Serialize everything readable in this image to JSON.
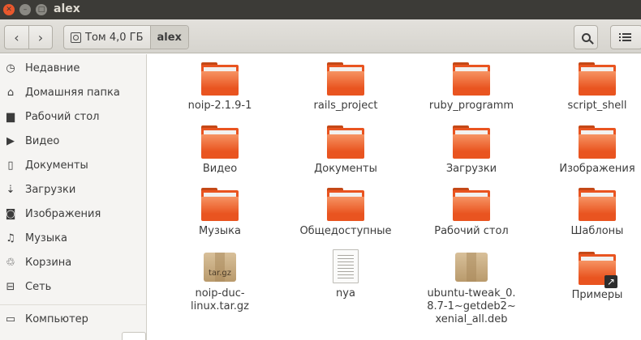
{
  "window": {
    "title": "alex"
  },
  "toolbar": {
    "back_icon": "‹",
    "forward_icon": "›",
    "path": [
      {
        "label": "Том 4,0 ГБ",
        "icon": "disk-icon"
      },
      {
        "label": "alex"
      }
    ],
    "search_icon": "search-icon",
    "view_icon": "list-view-icon"
  },
  "sidebar": {
    "items": [
      {
        "label": "Недавние",
        "icon": "clock-icon",
        "glyph": "◷"
      },
      {
        "label": "Домашняя папка",
        "icon": "home-icon",
        "glyph": "⌂"
      },
      {
        "label": "Рабочий стол",
        "icon": "desktop-folder-icon",
        "glyph": "▆"
      },
      {
        "label": "Видео",
        "icon": "video-icon",
        "glyph": "▶"
      },
      {
        "label": "Документы",
        "icon": "document-icon",
        "glyph": "▯"
      },
      {
        "label": "Загрузки",
        "icon": "download-icon",
        "glyph": "⇣"
      },
      {
        "label": "Изображения",
        "icon": "camera-icon",
        "glyph": "◙"
      },
      {
        "label": "Музыка",
        "icon": "music-icon",
        "glyph": "♫"
      },
      {
        "label": "Корзина",
        "icon": "trash-icon",
        "glyph": "♲"
      },
      {
        "label": "Сеть",
        "icon": "network-icon",
        "glyph": "⊟"
      },
      {
        "label": "Компьютер",
        "icon": "computer-icon",
        "glyph": "▭"
      }
    ]
  },
  "files": [
    {
      "name": "noip-2.1.9-1",
      "type": "folder"
    },
    {
      "name": "rails_project",
      "type": "folder"
    },
    {
      "name": "ruby_programm",
      "type": "folder"
    },
    {
      "name": "script_shell",
      "type": "folder"
    },
    {
      "name": "Видео",
      "type": "folder"
    },
    {
      "name": "Документы",
      "type": "folder"
    },
    {
      "name": "Загрузки",
      "type": "folder"
    },
    {
      "name": "Изображения",
      "type": "folder"
    },
    {
      "name": "Музыка",
      "type": "folder"
    },
    {
      "name": "Общедоступные",
      "type": "folder"
    },
    {
      "name": "Рабочий стол",
      "type": "folder"
    },
    {
      "name": "Шаблоны",
      "type": "folder"
    },
    {
      "name": "noip-duc-linux.tar.gz",
      "type": "archive",
      "badge": "tar.gz"
    },
    {
      "name": "nya",
      "type": "text"
    },
    {
      "name": "ubuntu-tweak_0.8.7-1~getdeb2~xenial_all.deb",
      "type": "package"
    },
    {
      "name": "Примеры",
      "type": "folder-link"
    }
  ],
  "colors": {
    "accent": "#e95420",
    "titlebar": "#3c3b37"
  }
}
